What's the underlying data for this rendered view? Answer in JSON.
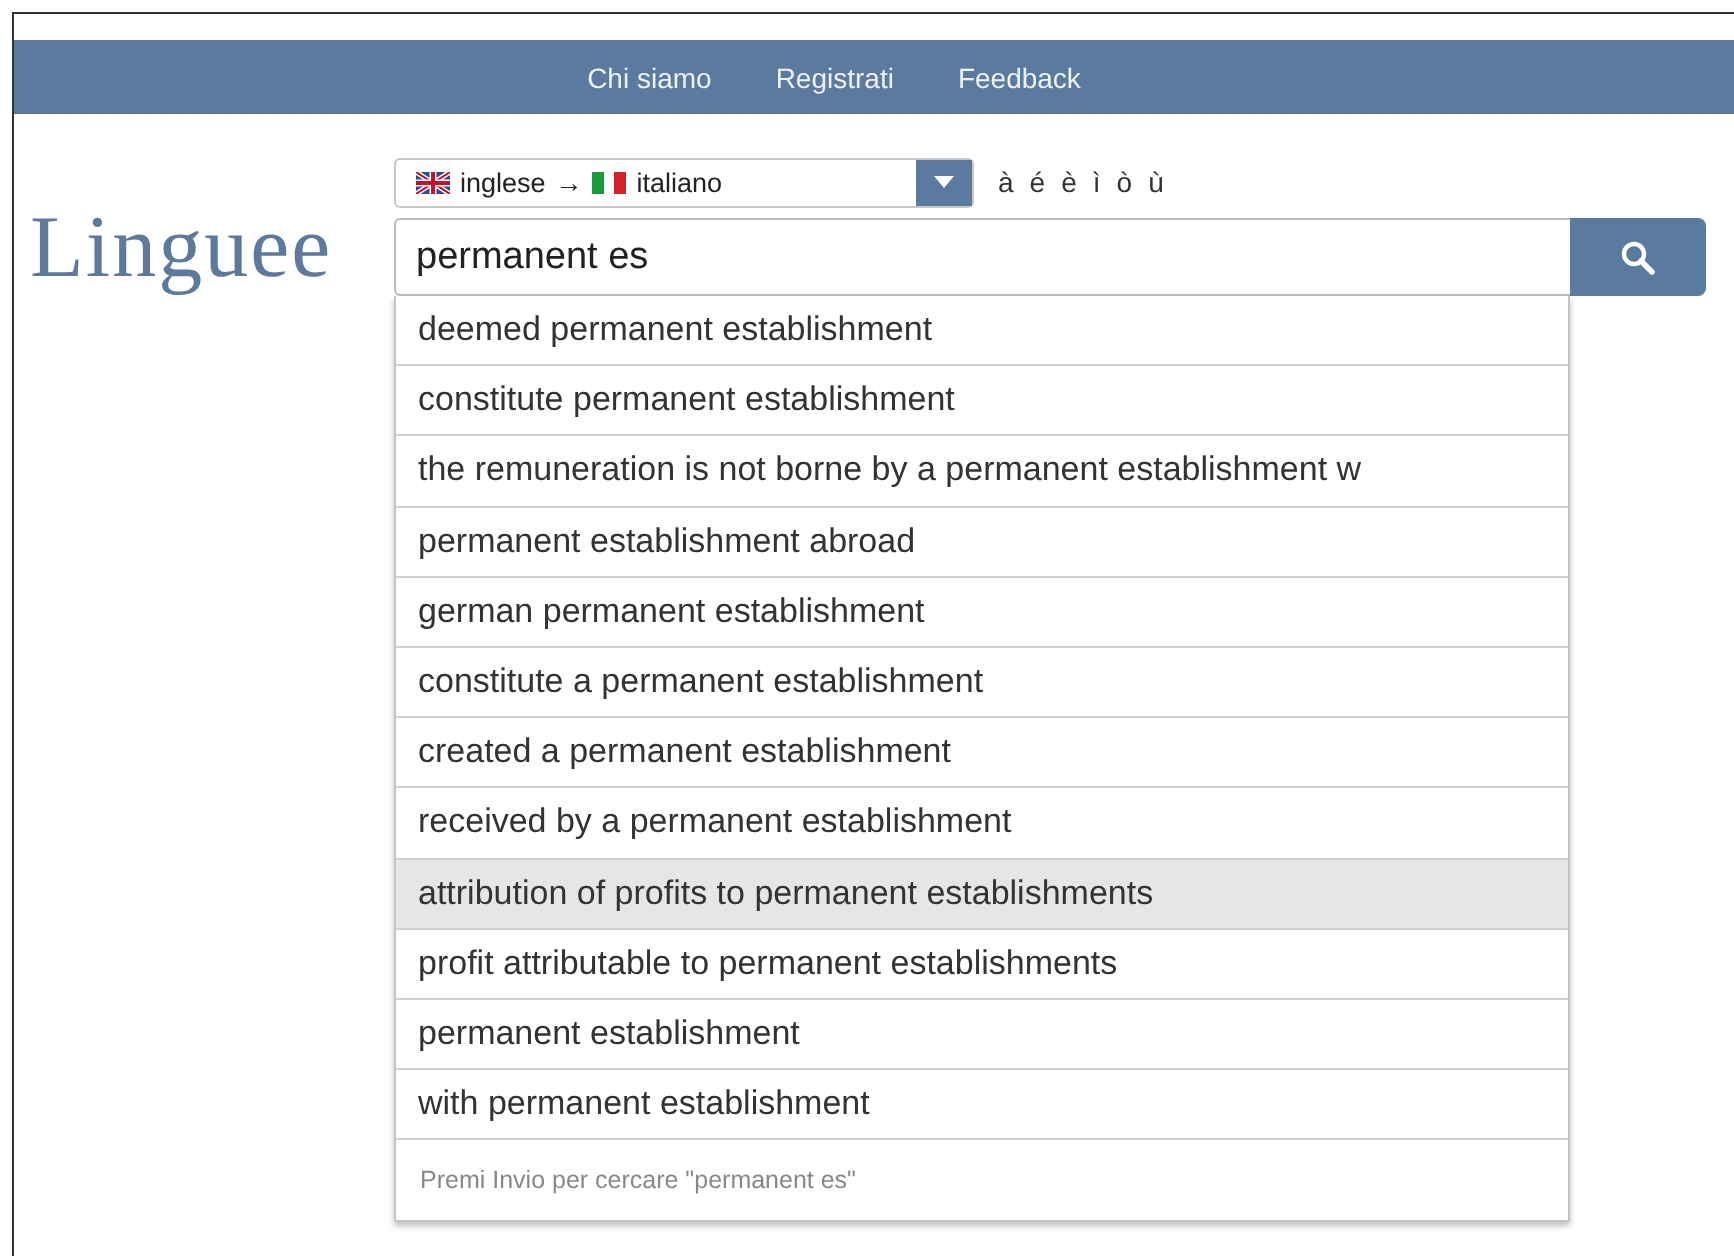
{
  "nav": [
    "Chi siamo",
    "Registrati",
    "Feedback"
  ],
  "logo": "Linguee",
  "language_select": {
    "source": "inglese",
    "arrow": "→",
    "target": "italiano"
  },
  "accents": [
    "à",
    "é",
    "è",
    "ì",
    "ò",
    "ù"
  ],
  "search": {
    "value": "permanent es"
  },
  "suggestions": [
    {
      "text": "deemed permanent establishment",
      "selected": false
    },
    {
      "text": "constitute permanent establishment",
      "selected": false
    },
    {
      "text": "the remuneration is not borne by a permanent establishment w",
      "selected": false
    },
    {
      "text": "permanent establishment abroad",
      "selected": false
    },
    {
      "text": "german permanent establishment",
      "selected": false
    },
    {
      "text": "constitute a permanent establishment",
      "selected": false
    },
    {
      "text": "created a permanent establishment",
      "selected": false
    },
    {
      "text": "received by a permanent establishment",
      "selected": false
    },
    {
      "text": "attribution of profits to permanent establishments",
      "selected": true
    },
    {
      "text": "profit attributable to permanent establishments",
      "selected": false
    },
    {
      "text": "permanent establishment",
      "selected": false
    },
    {
      "text": "with permanent establishment",
      "selected": false
    }
  ],
  "hint": "Premi Invio per cercare \"permanent es\""
}
